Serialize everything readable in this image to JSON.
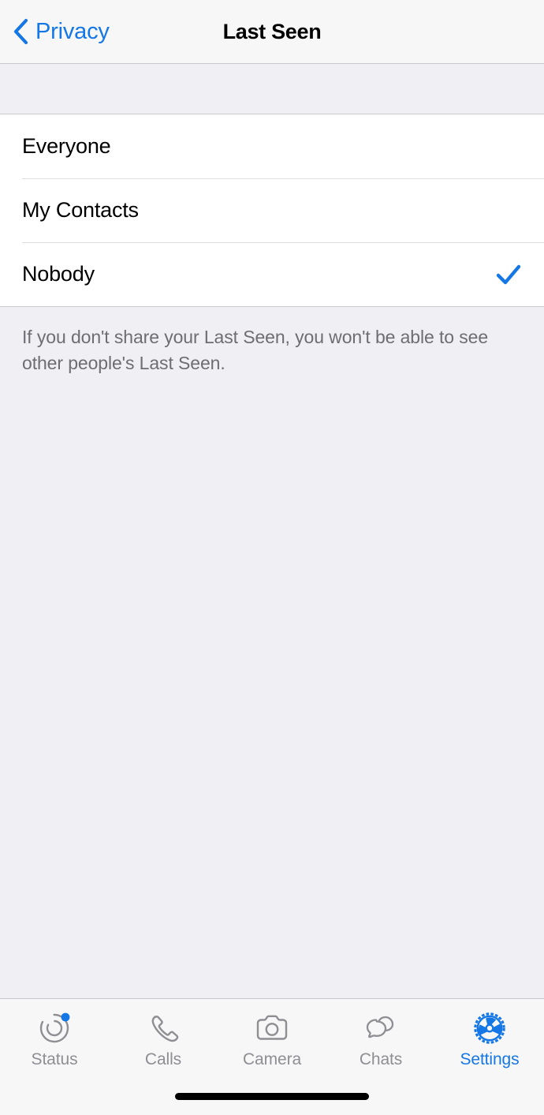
{
  "navbar": {
    "back_label": "Privacy",
    "back_icon": "chevron-left-icon",
    "title": "Last Seen"
  },
  "options": {
    "items": [
      {
        "label": "Everyone",
        "selected": false
      },
      {
        "label": "My Contacts",
        "selected": false
      },
      {
        "label": "Nobody",
        "selected": true
      }
    ],
    "check_icon": "checkmark-icon"
  },
  "footer": {
    "note": "If you don't share your Last Seen, you won't be able to see other people's Last Seen."
  },
  "tabbar": {
    "items": [
      {
        "label": "Status",
        "icon": "status-rings-icon",
        "active": false,
        "badge": true
      },
      {
        "label": "Calls",
        "icon": "phone-handset-icon",
        "active": false,
        "badge": false
      },
      {
        "label": "Camera",
        "icon": "camera-icon",
        "active": false,
        "badge": false
      },
      {
        "label": "Chats",
        "icon": "speech-bubbles-icon",
        "active": false,
        "badge": false
      },
      {
        "label": "Settings",
        "icon": "gear-icon",
        "active": true,
        "badge": false
      }
    ]
  },
  "home_indicator": {
    "icon": "home-indicator-bar"
  },
  "colors": {
    "accent": "#1577e6",
    "inactive": "#8e8e93",
    "background": "#efeff4",
    "bar": "#f7f7f7",
    "separator": "#c9c9ce",
    "note_text": "#6d6d72"
  }
}
